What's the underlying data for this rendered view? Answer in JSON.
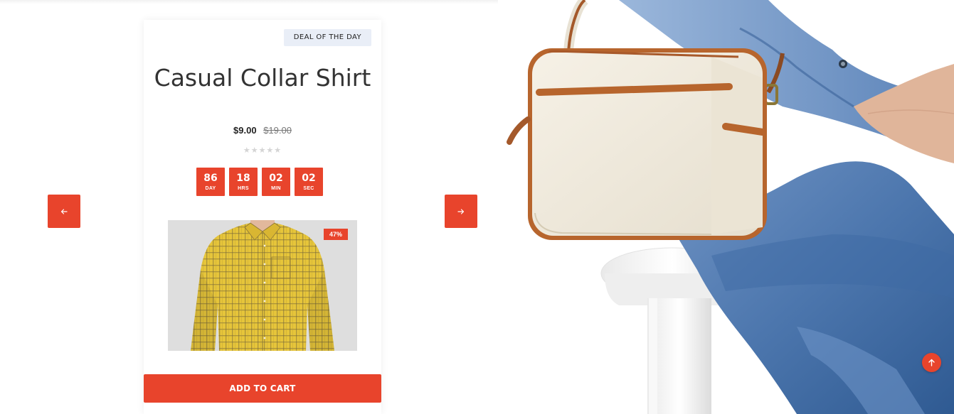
{
  "deal": {
    "badge": "DEAL OF THE DAY",
    "title": "Casual Collar Shirt",
    "price_current": "$9.00",
    "price_old": "$19.00",
    "rating_stars": "★★★★★",
    "rating_value": 0,
    "countdown": [
      {
        "value": "86",
        "unit": "DAY"
      },
      {
        "value": "18",
        "unit": "HRS"
      },
      {
        "value": "02",
        "unit": "MIN"
      },
      {
        "value": "02",
        "unit": "SEC"
      }
    ],
    "discount": "47%",
    "add_to_cart": "ADD TO CART"
  },
  "icons": {
    "prev": "arrow-left-icon",
    "next": "arrow-right-icon",
    "scroll_top": "arrow-up-icon"
  },
  "colors": {
    "accent": "#e8442c",
    "badge_bg": "#e9eef7",
    "text_dark": "#333333",
    "star_empty": "#d4d4d4"
  }
}
